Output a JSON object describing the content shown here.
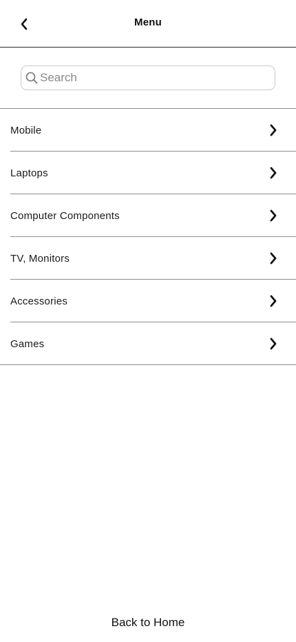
{
  "header": {
    "title": "Menu",
    "back_icon": "chevron-left-icon"
  },
  "search": {
    "placeholder": "Search",
    "value": "",
    "icon": "search-icon"
  },
  "menu": {
    "items": [
      {
        "label": "Mobile",
        "icon": "chevron-right-icon"
      },
      {
        "label": "Laptops",
        "icon": "chevron-right-icon"
      },
      {
        "label": "Computer Components",
        "icon": "chevron-right-icon"
      },
      {
        "label": "TV, Monitors",
        "icon": "chevron-right-icon"
      },
      {
        "label": "Accessories",
        "icon": "chevron-right-icon"
      },
      {
        "label": "Games",
        "icon": "chevron-right-icon"
      }
    ]
  },
  "footer": {
    "back_home_label": "Back to Home"
  },
  "colors": {
    "background": "#ffffff",
    "text": "#111111",
    "divider": "#8c8c8c",
    "header_border": "#2b2b2b",
    "search_border": "#c9c9c9",
    "placeholder": "#8a8a8a"
  }
}
